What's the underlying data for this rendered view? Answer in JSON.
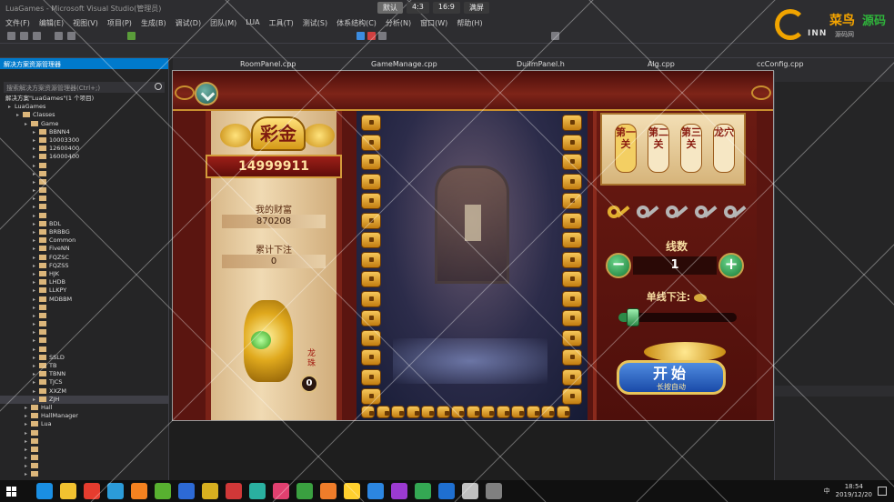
{
  "player": {
    "options": [
      "默认",
      "4:3",
      "16:9",
      "满屏"
    ],
    "active_index": 0
  },
  "logo": {
    "brand_a": "菜鸟",
    "brand_b": "源码",
    "sub": "INN",
    "sub2": "源码网"
  },
  "ide": {
    "window_title": "LuaGames - Microsoft Visual Studio(管理员)",
    "menu": [
      "文件(F)",
      "编辑(E)",
      "视图(V)",
      "项目(P)",
      "生成(B)",
      "调试(D)",
      "团队(M)",
      "LUA",
      "工具(T)",
      "测试(S)",
      "体系结构(C)",
      "分析(N)",
      "窗口(W)",
      "帮助(H)"
    ],
    "tabs": [
      "RoomPanel.cpp",
      "GameManage.cpp",
      "DuiImPanel.h",
      "Alg.cpp",
      "ccConfig.cpp"
    ]
  },
  "solution": {
    "panel_title": "解决方案资源管理器",
    "search_placeholder": "搜索解决方案资源管理器(Ctrl+;)",
    "root": "解决方案\"LuaGames\"(1 个项目)",
    "items": [
      {
        "label": "LuaGames",
        "level": 1,
        "folder": false
      },
      {
        "label": "Classes",
        "level": 2,
        "folder": true
      },
      {
        "label": "Game",
        "level": 3,
        "folder": true
      },
      {
        "label": "BBNN4",
        "level": 4,
        "folder": true
      },
      {
        "label": "10003300",
        "level": 4,
        "folder": true
      },
      {
        "label": "12600400",
        "level": 4,
        "folder": true
      },
      {
        "label": "16000400",
        "level": 4,
        "folder": true
      },
      {
        "label": "",
        "level": 4,
        "folder": true
      },
      {
        "label": "",
        "level": 4,
        "folder": true
      },
      {
        "label": "",
        "level": 4,
        "folder": true
      },
      {
        "label": "",
        "level": 4,
        "folder": true
      },
      {
        "label": "",
        "level": 4,
        "folder": true
      },
      {
        "label": "",
        "level": 4,
        "folder": true
      },
      {
        "label": "",
        "level": 4,
        "folder": true
      },
      {
        "label": "BDL",
        "level": 4,
        "folder": true
      },
      {
        "label": "BRBBG",
        "level": 4,
        "folder": true
      },
      {
        "label": "Common",
        "level": 4,
        "folder": true
      },
      {
        "label": "FiveNN",
        "level": 4,
        "folder": true
      },
      {
        "label": "FQZSC",
        "level": 4,
        "folder": true
      },
      {
        "label": "FQZSS",
        "level": 4,
        "folder": true
      },
      {
        "label": "HJK",
        "level": 4,
        "folder": true
      },
      {
        "label": "LHDB",
        "level": 4,
        "folder": true
      },
      {
        "label": "LLKPY",
        "level": 4,
        "folder": true
      },
      {
        "label": "MDBBM",
        "level": 4,
        "folder": true
      },
      {
        "label": "",
        "level": 4,
        "folder": true
      },
      {
        "label": "",
        "level": 4,
        "folder": true
      },
      {
        "label": "",
        "level": 4,
        "folder": true
      },
      {
        "label": "",
        "level": 4,
        "folder": true
      },
      {
        "label": "",
        "level": 4,
        "folder": true
      },
      {
        "label": "",
        "level": 4,
        "folder": true
      },
      {
        "label": "SSLD",
        "level": 4,
        "folder": true
      },
      {
        "label": "TB",
        "level": 4,
        "folder": true
      },
      {
        "label": "TBNN",
        "level": 4,
        "folder": true
      },
      {
        "label": "TJCS",
        "level": 4,
        "folder": true
      },
      {
        "label": "XXZM",
        "level": 4,
        "folder": true
      },
      {
        "label": "ZJH",
        "level": 4,
        "folder": true,
        "selected": true
      },
      {
        "label": "Hall",
        "level": 3,
        "folder": true
      },
      {
        "label": "HallManager",
        "level": 3,
        "folder": true
      },
      {
        "label": "Lua",
        "level": 3,
        "folder": true
      },
      {
        "label": "",
        "level": 3,
        "folder": true
      },
      {
        "label": "",
        "level": 3,
        "folder": true
      },
      {
        "label": "",
        "level": 3,
        "folder": true
      },
      {
        "label": "",
        "level": 3,
        "folder": true
      },
      {
        "label": "",
        "level": 3,
        "folder": true
      },
      {
        "label": "",
        "level": 3,
        "folder": true
      }
    ]
  },
  "game": {
    "jackpot_title": "彩金",
    "jackpot_value": "14999911",
    "wealth_label": "我的财富",
    "wealth_value": "870208",
    "total_bet_label": "累计下注",
    "total_bet_value": "0",
    "dragon_tag": "龙珠",
    "round_count": "0",
    "levels": [
      {
        "label": "第一关",
        "active": true
      },
      {
        "label": "第二关",
        "active": false
      },
      {
        "label": "第三关",
        "active": false
      },
      {
        "label": "龙穴",
        "active": false
      }
    ],
    "keys": [
      true,
      false,
      false,
      false,
      false
    ],
    "lines_label": "线数",
    "lines_value": "1",
    "minus_symbol": "−",
    "plus_symbol": "+",
    "line_bet_label": "单线下注:",
    "bet_slider_level": 0.1,
    "start_label": "开始",
    "start_sub": "长按自动"
  },
  "taskbar": {
    "time": "18:54",
    "date": "2019/12/20",
    "tray_text": "中",
    "app_colors": [
      "#1a8fe3",
      "#f2c230",
      "#e63c2e",
      "#2b9bd8",
      "#f58220",
      "#58b030",
      "#2d6ad5",
      "#d8b020",
      "#d03838",
      "#2ab0a0",
      "#e04070",
      "#3aa040",
      "#ef7d2a",
      "#ffd02e",
      "#2c86e0",
      "#9b3ad0",
      "#34a853",
      "#1f6fd0",
      "#c0c0c0",
      "#808080"
    ]
  }
}
